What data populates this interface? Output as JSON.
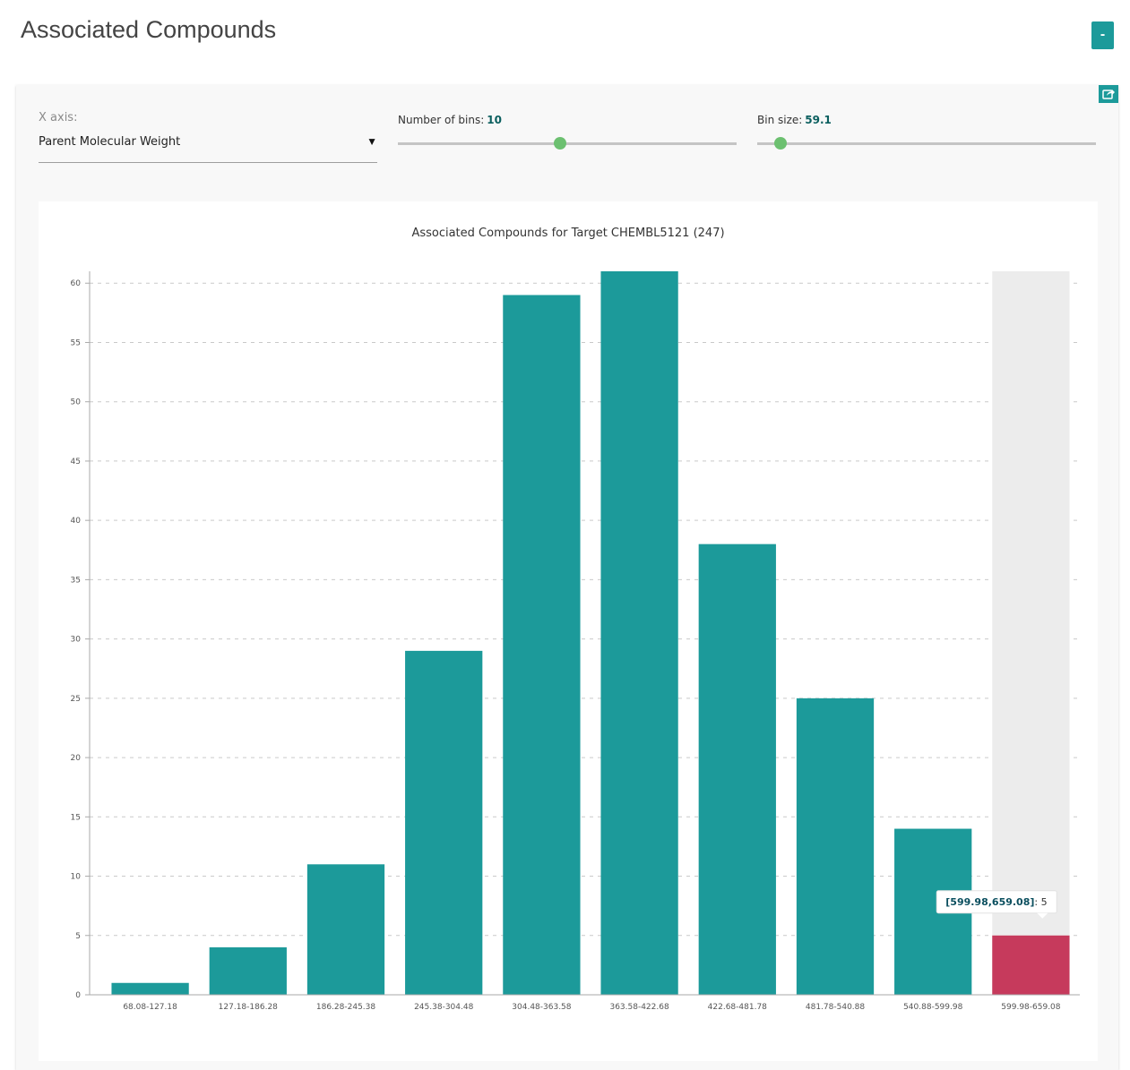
{
  "page": {
    "title": "Associated Compounds",
    "collapse_label": "-"
  },
  "controls": {
    "x_axis_label": "X axis:",
    "x_axis_value": "Parent Molecular Weight",
    "bins_label": "Number of bins:",
    "bins_value": "10",
    "bins_fraction": 0.48,
    "bin_size_label": "Bin size:",
    "bin_size_value": "59.1",
    "bin_size_fraction": 0.07
  },
  "icons": {
    "share": "share-icon",
    "caret": "caret-down-icon"
  },
  "colors": {
    "bar": "#1c9a9a",
    "highlight_bar": "#c63a5c",
    "hover_band": "#ececec",
    "accent": "#1c9a9a",
    "slider_thumb": "#6cc070"
  },
  "chart_data": {
    "type": "bar",
    "title": "Associated Compounds for Target CHEMBL5121 (247)",
    "xlabel": "",
    "ylabel": "",
    "categories": [
      "68.08-127.18",
      "127.18-186.28",
      "186.28-245.38",
      "245.38-304.48",
      "304.48-363.58",
      "363.58-422.68",
      "422.68-481.78",
      "481.78-540.88",
      "540.88-599.98",
      "599.98-659.08"
    ],
    "values": [
      1,
      4,
      11,
      29,
      59,
      61,
      38,
      25,
      14,
      5
    ],
    "ylim": [
      0,
      61
    ],
    "yticks": [
      0,
      5,
      10,
      15,
      20,
      25,
      30,
      35,
      40,
      45,
      50,
      55,
      60
    ],
    "grid": true,
    "highlighted_index": 9,
    "tooltip": {
      "key": "[599.98,659.08]",
      "separator": ":",
      "value": "5"
    }
  }
}
